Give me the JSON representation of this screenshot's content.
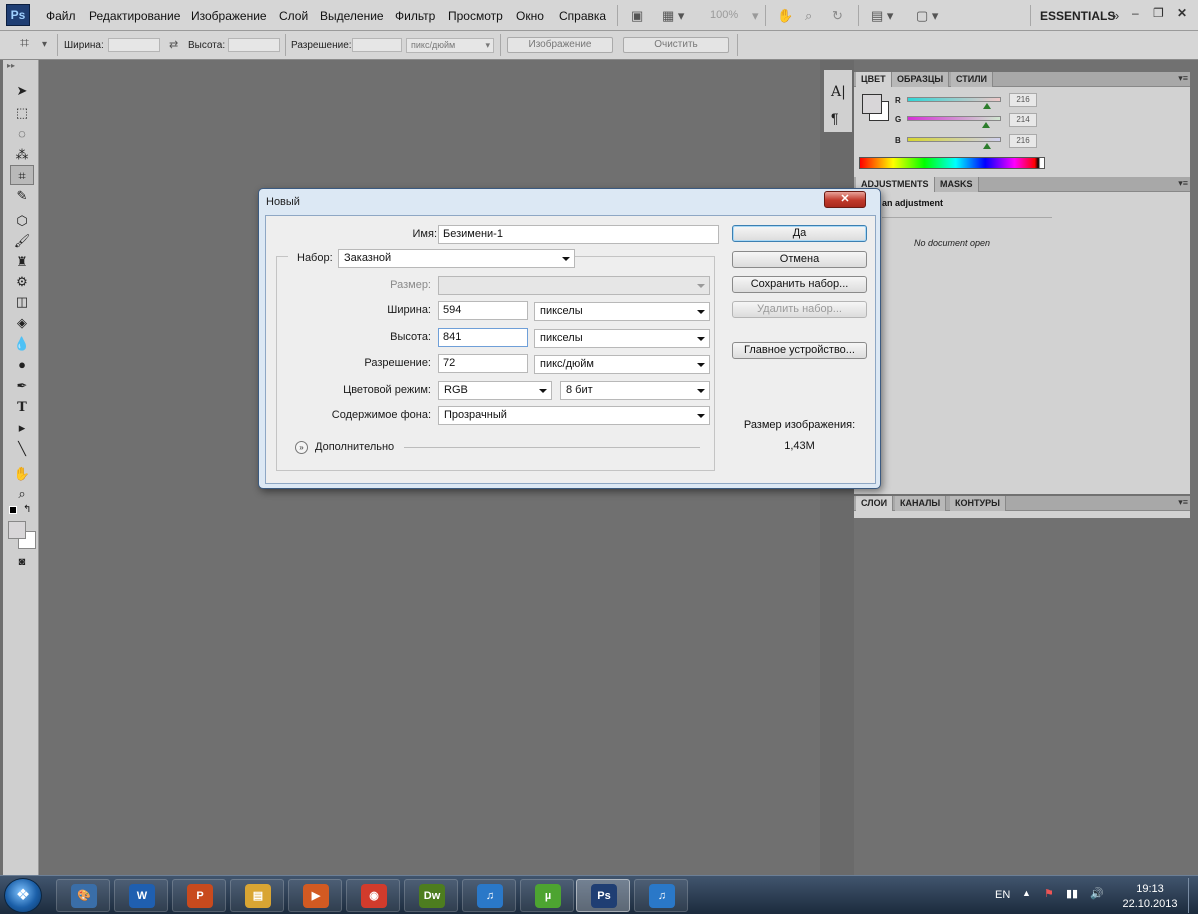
{
  "app": {
    "logo_text": "Ps",
    "workspace": "ESSENTIALS"
  },
  "menu": [
    "Файл",
    "Редактирование",
    "Изображение",
    "Слой",
    "Выделение",
    "Фильтр",
    "Просмотр",
    "Окно",
    "Справка"
  ],
  "menubar": {
    "zoom": "100%"
  },
  "options_bar": {
    "width_label": "Ширина:",
    "height_label": "Высота:",
    "resolution_label": "Разрешение:",
    "resolution_units": "пикс/дюйм",
    "image_button": "Изображение",
    "clear_button": "Очистить"
  },
  "tools": [
    "move-tool",
    "marquee-tool",
    "lasso-tool",
    "magic-wand-tool",
    "crop-tool",
    "eyedropper-tool",
    "healing-tool",
    "brush-tool",
    "clone-stamp-tool",
    "history-brush-tool",
    "eraser-tool",
    "paint-bucket-tool",
    "blur-tool",
    "dodge-tool",
    "pen-tool",
    "type-tool",
    "path-selection-tool",
    "line-tool",
    "hand-tool",
    "zoom-tool"
  ],
  "color_panel": {
    "tabs": [
      "ЦВЕТ",
      "ОБРАЗЦЫ",
      "СТИЛИ"
    ],
    "channels": [
      {
        "label": "R",
        "value": "216",
        "fraction": 0.85,
        "gradient": "#d8d8d8",
        "accent": "#2fd6d6"
      },
      {
        "label": "G",
        "value": "214",
        "fraction": 0.84,
        "gradient": "#d8d8d8",
        "accent": "#d62fd6"
      },
      {
        "label": "B",
        "value": "216",
        "fraction": 0.85,
        "gradient": "#d8d8d8",
        "accent": "#d6d62f"
      }
    ]
  },
  "adjustments_panel": {
    "tabs": [
      "ADJUSTMENTS",
      "MASKS"
    ],
    "header": "an adjustment",
    "empty_message": "No document open"
  },
  "layers_panel": {
    "tabs": [
      "СЛОИ",
      "КАНАЛЫ",
      "КОНТУРЫ"
    ]
  },
  "dialog": {
    "title": "Новый",
    "close": "✕",
    "name_label": "Имя:",
    "name_value": "Безимени-1",
    "preset_label": "Набор:",
    "preset_value": "Заказной",
    "size_label": "Размер:",
    "size_value": "",
    "width_label": "Ширина:",
    "width_value": "594",
    "width_units": "пикселы",
    "height_label": "Высота:",
    "height_value": "841",
    "height_units": "пикселы",
    "resolution_label": "Разрешение:",
    "resolution_value": "72",
    "resolution_units": "пикс/дюйм",
    "color_mode_label": "Цветовой режим:",
    "color_mode_value": "RGB",
    "bit_depth_value": "8 бит",
    "background_label": "Содержимое фона:",
    "background_value": "Прозрачный",
    "advanced_label": "Дополнительно",
    "buttons": {
      "ok": "Да",
      "cancel": "Отмена",
      "save_preset": "Сохранить набор...",
      "delete_preset": "Удалить набор...",
      "device_central": "Главное устройство..."
    },
    "image_size_label": "Размер изображения:",
    "image_size_value": "1,43M"
  },
  "taskbar": {
    "apps": [
      {
        "name": "paint-app",
        "glyph": "🎨",
        "color": "#3a6ea8"
      },
      {
        "name": "word-app",
        "glyph": "W",
        "color": "#1f5fb0"
      },
      {
        "name": "powerpoint-app",
        "glyph": "P",
        "color": "#c84a1e"
      },
      {
        "name": "explorer-app",
        "glyph": "▤",
        "color": "#d9a533"
      },
      {
        "name": "media-player-app",
        "glyph": "▶",
        "color": "#d25a22"
      },
      {
        "name": "chrome-app",
        "glyph": "◉",
        "color": "#d13b2c"
      },
      {
        "name": "dreamweaver-app",
        "glyph": "Dw",
        "color": "#4d7d1f"
      },
      {
        "name": "itunes-app",
        "glyph": "♫",
        "color": "#2a78c8"
      },
      {
        "name": "utorrent-app",
        "glyph": "µ",
        "color": "#4da431"
      },
      {
        "name": "photoshop-app",
        "glyph": "Ps",
        "color": "#1f3e73"
      },
      {
        "name": "itunes-app-2",
        "glyph": "♫",
        "color": "#2a78c8"
      }
    ],
    "language": "EN",
    "time": "19:13",
    "date": "22.10.2013"
  }
}
